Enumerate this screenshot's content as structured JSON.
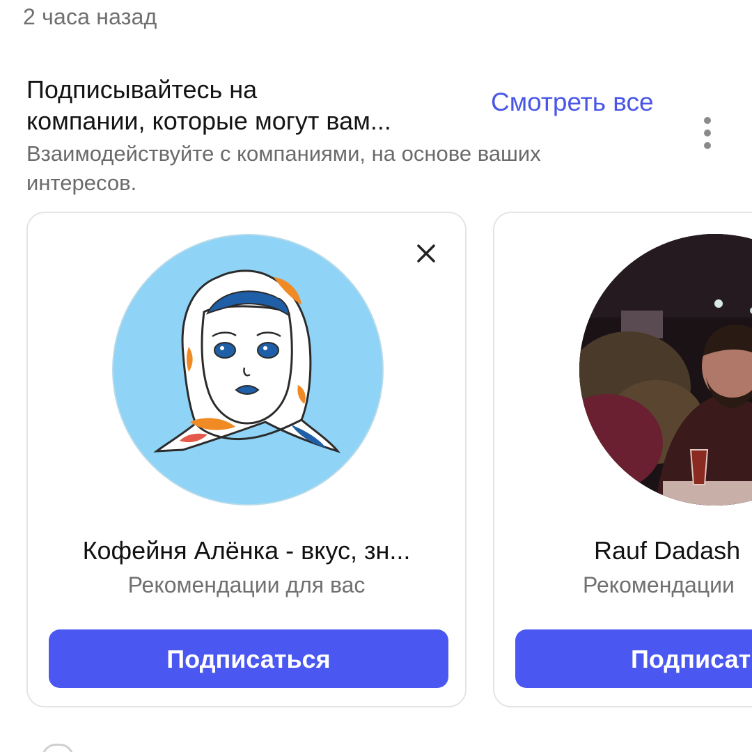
{
  "post": {
    "timestamp": "2 часа назад"
  },
  "section": {
    "title_line1": "Подписывайтесь на",
    "title_line2": "компании, которые могут вам...",
    "see_all_label": "Смотреть все",
    "subtitle": "Взаимодействуйте с компаниями, на основе ваших интересов."
  },
  "cards": [
    {
      "name": "Кофейня Алёнка - вкус, зн...",
      "subtitle": "Рекомендации для вас",
      "button_label": "Подписаться",
      "avatar_icon": "alenka-logo",
      "dismiss_icon": "close-icon"
    },
    {
      "name": "Rauf Dadash",
      "subtitle": "Рекомендации",
      "button_label": "Подписат",
      "avatar_icon": "person-photo"
    }
  ],
  "colors": {
    "accent": "#4a57f1",
    "link": "#4a57e6",
    "avatar_bg": "#8fd3f7"
  }
}
